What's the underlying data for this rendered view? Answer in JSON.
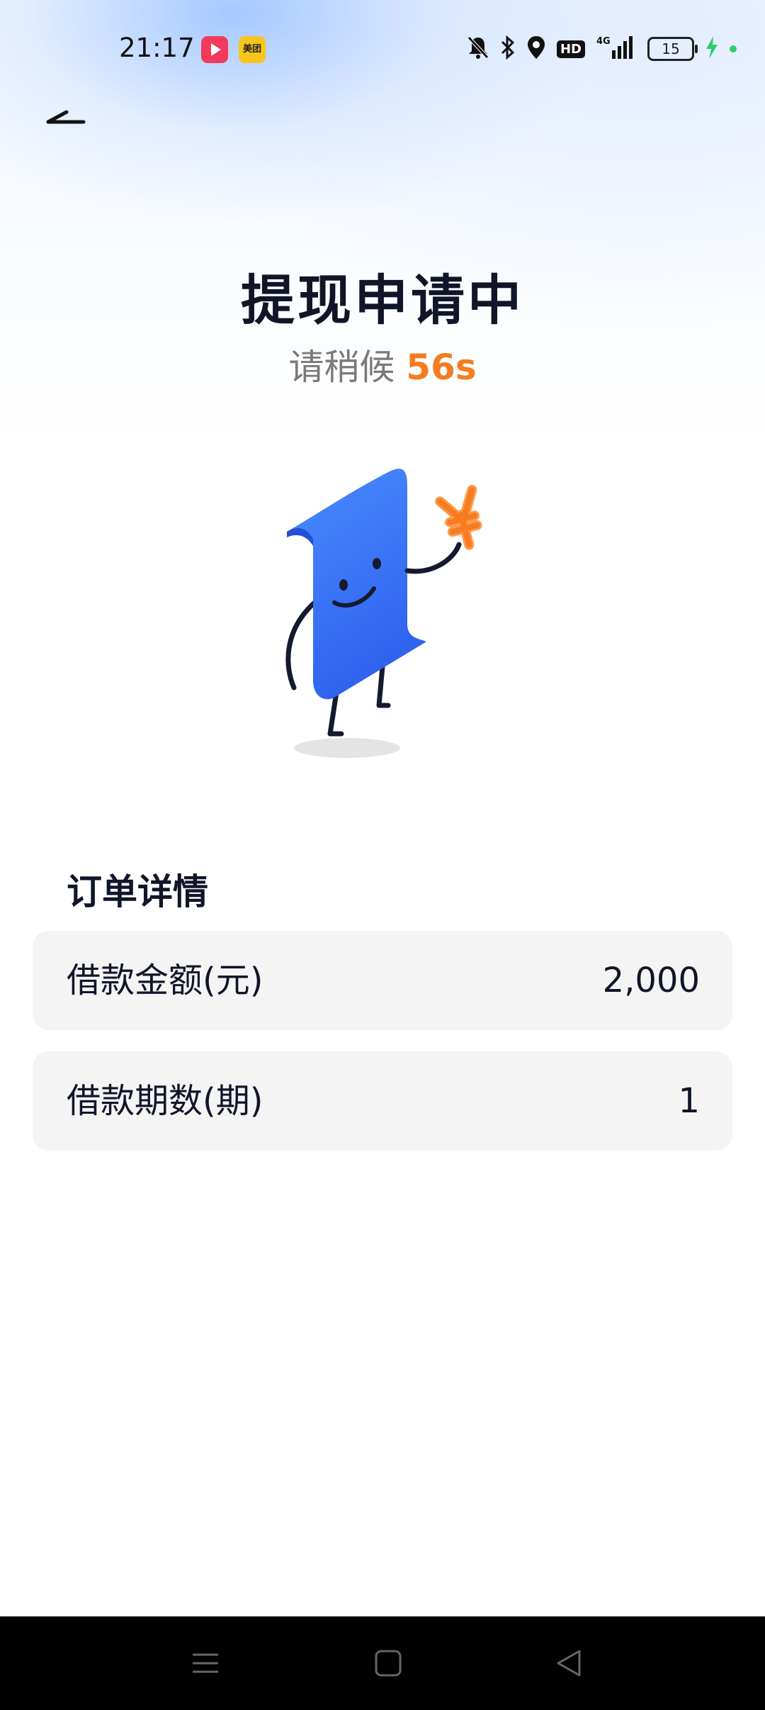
{
  "status_bar": {
    "time": "21:17",
    "meituan_label": "美团",
    "battery_level": "15",
    "network_label": "4G"
  },
  "header": {
    "title": "提现申请中",
    "wait_text": "请稍候",
    "countdown": "56s"
  },
  "order": {
    "section_title": "订单详情",
    "rows": [
      {
        "label": "借款金额(元)",
        "value": "2,000"
      },
      {
        "label": "借款期数(期)",
        "value": "1"
      }
    ]
  },
  "colors": {
    "accent_orange": "#f57c1f",
    "illustration_blue": "#3d74f5",
    "title_text": "#111528"
  },
  "icons": {
    "back": "back-arrow-icon",
    "mute": "bell-off-icon",
    "bluetooth": "bluetooth-icon",
    "location": "location-pin-icon",
    "signal": "signal-icon",
    "charging": "lightning-icon"
  }
}
